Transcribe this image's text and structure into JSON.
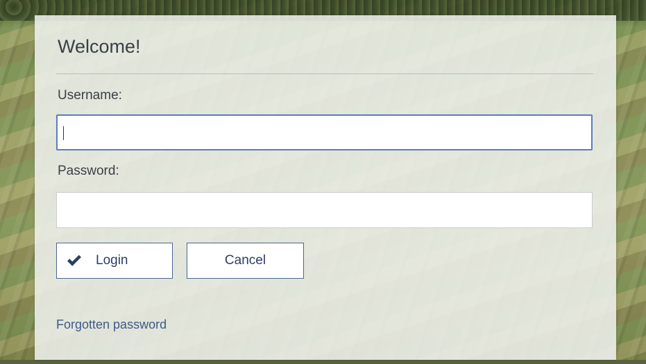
{
  "dialog": {
    "title": "Welcome!"
  },
  "form": {
    "username": {
      "label": "Username:",
      "value": ""
    },
    "password": {
      "label": "Password:",
      "value": ""
    }
  },
  "buttons": {
    "login_label": "Login",
    "login_icon": "checkmark-icon",
    "cancel_label": "Cancel"
  },
  "links": {
    "forgot_password": "Forgotten password"
  },
  "colors": {
    "accent": "#2c3e66",
    "link": "#3e5a8a",
    "focus_border": "#5b7cc0"
  }
}
